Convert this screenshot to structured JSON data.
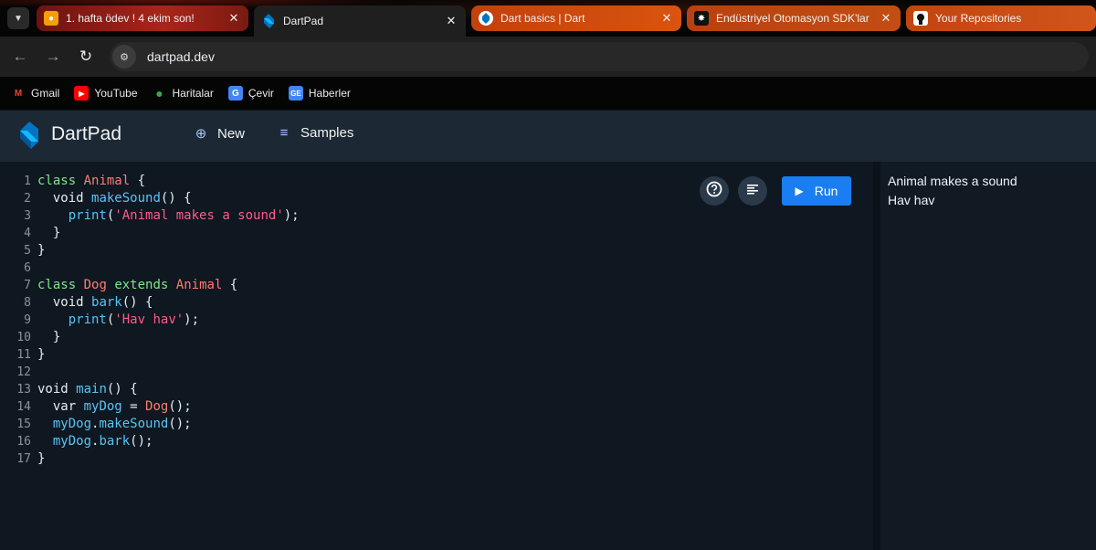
{
  "browser": {
    "tabs": [
      {
        "title": "1. hafta ödev ! 4 ekim son!",
        "icon": "classroom-icon"
      },
      {
        "title": "DartPad",
        "icon": "dart-icon"
      },
      {
        "title": "Dart basics | Dart",
        "icon": "dart-icon"
      },
      {
        "title": "Endüstriyel Otomasyon SDK'lar",
        "icon": "chatgpt-icon"
      },
      {
        "title": "Your Repositories",
        "icon": "github-icon"
      }
    ],
    "url": "dartpad.dev",
    "bookmarks": [
      {
        "label": "Gmail",
        "icon": "gmail-icon"
      },
      {
        "label": "YouTube",
        "icon": "youtube-icon"
      },
      {
        "label": "Haritalar",
        "icon": "maps-icon"
      },
      {
        "label": "Çevir",
        "icon": "translate-icon"
      },
      {
        "label": "Haberler",
        "icon": "news-icon"
      }
    ]
  },
  "app": {
    "title": "DartPad",
    "new_label": "New",
    "samples_label": "Samples",
    "run_label": "Run"
  },
  "editor": {
    "line_numbers": [
      "1",
      "2",
      "3",
      "4",
      "5",
      "6",
      "7",
      "8",
      "9",
      "10",
      "11",
      "12",
      "13",
      "14",
      "15",
      "16",
      "17"
    ]
  },
  "output": {
    "lines": [
      "Animal makes a sound",
      "Hav hav"
    ]
  },
  "colors": {
    "run_button": "#1a7ef2",
    "header_bg": "#1c2834",
    "editor_bg": "#0f1720"
  }
}
